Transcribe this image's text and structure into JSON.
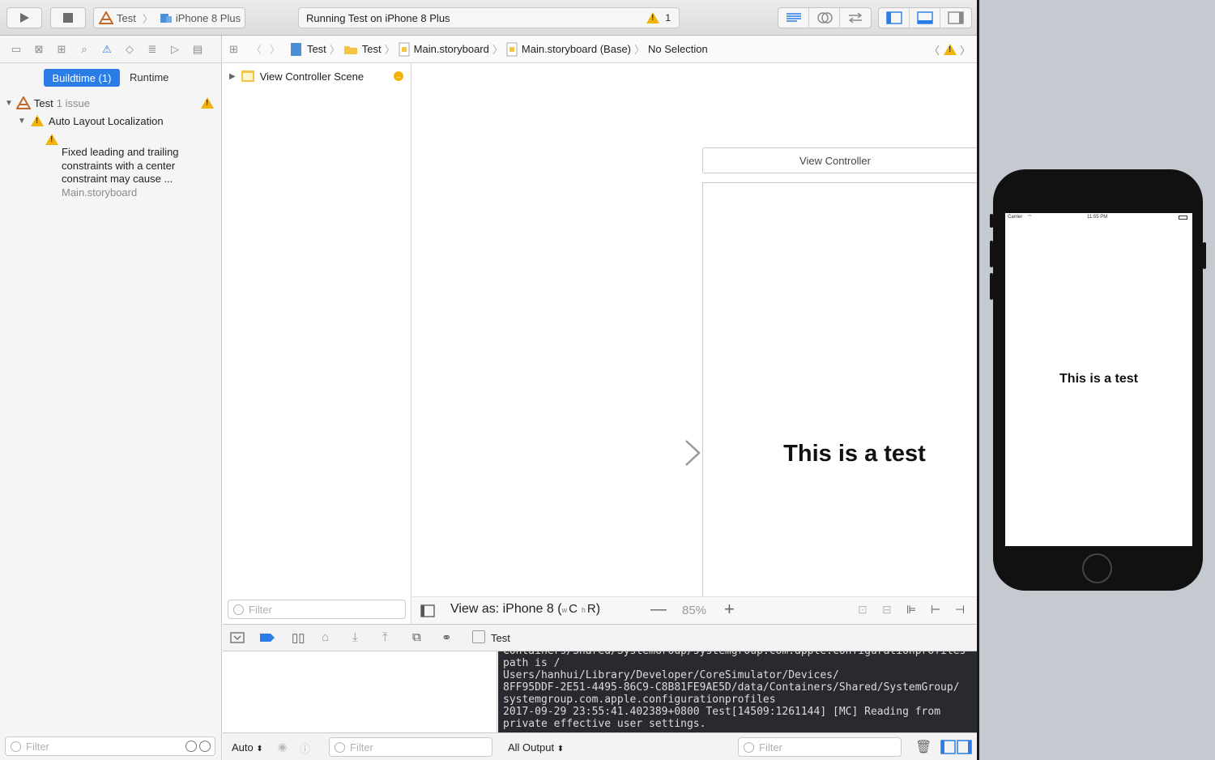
{
  "toolbar": {
    "scheme_app": "Test",
    "scheme_device": "iPhone 8 Plus",
    "status": "Running Test on iPhone 8 Plus",
    "warning_count": "1"
  },
  "navigator": {
    "tab_buildtime": "Buildtime (1)",
    "tab_runtime": "Runtime",
    "project_name": "Test",
    "project_issue_count": "1 issue",
    "group_label": "Auto Layout Localization",
    "issue_text": "Fixed leading and trailing constraints with a center constraint may cause ...",
    "issue_file": "Main.storyboard",
    "filter_placeholder": "Filter"
  },
  "jumpbar": {
    "crumbs": [
      "Test",
      "Test",
      "Main.storyboard",
      "Main.storyboard (Base)",
      "No Selection"
    ]
  },
  "outline": {
    "scene_label": "View Controller Scene",
    "filter_placeholder": "Filter"
  },
  "canvas": {
    "controller_title": "View Controller",
    "label_text": "This is a test",
    "view_as_prefix": "View as: iPhone 8 (",
    "view_as_w": "w",
    "view_as_c": "C",
    "view_as_h": "h",
    "view_as_r": "R",
    "view_as_suffix": ")",
    "zoom": "85%"
  },
  "debug": {
    "target": "Test",
    "auto_label": "Auto",
    "filter_placeholder": "Filter",
    "output_label": "All Output",
    "console_lines": [
      "Containers/Shared/SystemGroup/systemgroup.com.apple.configurationprofiles path is /",
      "Users/hanhui/Library/Developer/CoreSimulator/Devices/",
      "8FF95DDF-2E51-4495-86C9-C8B81FE9AE5D/data/Containers/Shared/SystemGroup/",
      "systemgroup.com.apple.configurationprofiles",
      "2017-09-29 23:55:41.402389+0800 Test[14509:1261144] [MC] Reading from",
      "private effective user settings."
    ]
  },
  "simulator": {
    "carrier": "Carrier",
    "time": "11:55 PM",
    "label_text": "This is a test"
  },
  "colors": {
    "accent": "#2a7ce6",
    "warning": "#f2b30c",
    "console_bg": "#292a30"
  }
}
